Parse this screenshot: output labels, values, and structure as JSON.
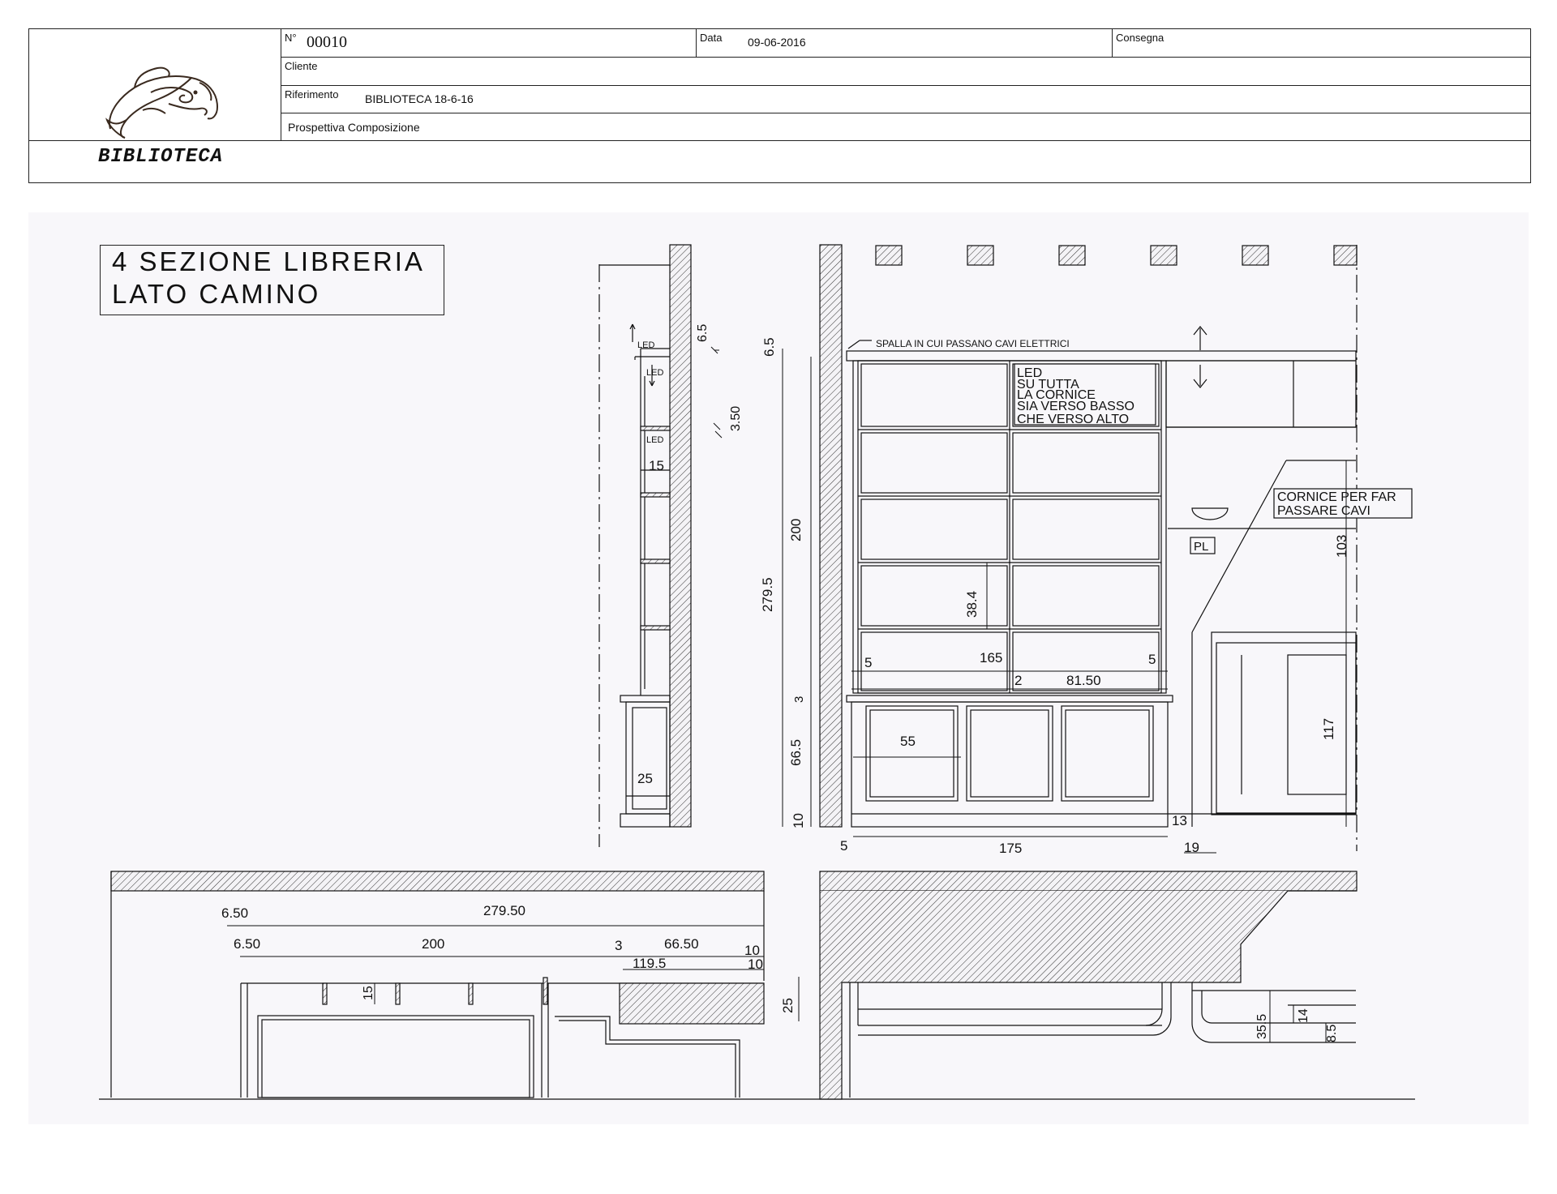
{
  "title_block": {
    "number_label": "N°",
    "number_value": "00010",
    "date_label": "Data",
    "date_value": "09-06-2016",
    "delivery_label": "Consegna",
    "client_label": "Cliente",
    "reference_label": "Riferimento",
    "reference_value": "BIBLIOTECA 18-6-16",
    "view_label": "Prospettiva Composizione",
    "project_name": "BIBLIOTECA",
    "logo_icon": "dolphin-logo-icon"
  },
  "drawing": {
    "section_title_line1": "4  SEZIONE  LIBRERIA",
    "section_title_line2": "LATO  CAMINO",
    "notes": {
      "spalla": "SPALLA  IN  CUI  PASSANO  CAVI  ELETTRICI",
      "led_block": [
        "LED",
        "SU  TUTTA",
        "LA  CORNICE",
        "SIA  VERSO  BASSO",
        "CHE  VERSO  ALTO"
      ],
      "cornice": [
        "CORNICE  PER  FAR",
        "PASSARE  CAVI"
      ],
      "pl": "PL",
      "led": "LED"
    },
    "side_section_dims": [
      "6.5",
      "3.50",
      "15",
      "25"
    ],
    "front_elevation_dims": {
      "d6_5": "6.5",
      "d279_5": "279.5",
      "d200": "200",
      "d3": "3",
      "d66_5": "66.5",
      "d10": "10",
      "d38_4": "38.4",
      "d165": "165",
      "d5a": "5",
      "d5b": "5",
      "d2": "2",
      "d81_50": "81.50",
      "d55": "55",
      "d13": "13",
      "d5c": "5",
      "d175": "175",
      "d19": "19",
      "d103": "103",
      "d117": "117"
    },
    "plan_dims": {
      "p6_50a": "6.50",
      "p279_50": "279.50",
      "p6_50b": "6.50",
      "p200": "200",
      "p3": "3",
      "p66_50": "66.50",
      "p10a": "10",
      "p119_5": "119.5",
      "p10b": "10",
      "p15": "15",
      "p25": "25",
      "p35_5": "35.5",
      "p14": "14",
      "p8_5": "8.5"
    }
  }
}
